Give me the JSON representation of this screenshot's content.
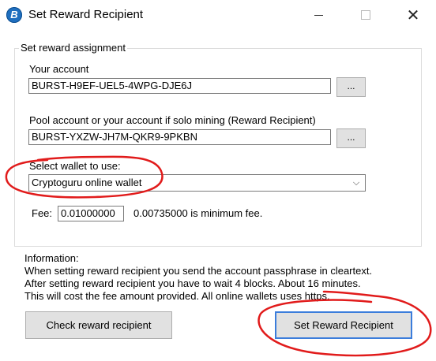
{
  "window": {
    "title": "Set Reward Recipient",
    "app_icon_glyph": "B",
    "controls": {
      "minimize_icon": "minimize-icon",
      "maximize_icon": "maximize-icon",
      "close_glyph": "✕"
    }
  },
  "group": {
    "label": "Set reward assignment",
    "your_account": {
      "label": "Your account",
      "value": "BURST-H9EF-UEL5-4WPG-DJE6J",
      "browse_label": "..."
    },
    "pool_account": {
      "label": "Pool account or your account if solo mining (Reward Recipient)",
      "value": "BURST-YXZW-JH7M-QKR9-9PKBN",
      "browse_label": "..."
    },
    "wallet": {
      "label": "Select wallet to use:",
      "selected": "Cryptoguru online wallet",
      "chevron_icon": "chevron-down-icon"
    },
    "fee": {
      "label": "Fee:",
      "value": "0.01000000",
      "note": "0.00735000 is minimum fee."
    }
  },
  "information": {
    "heading": "Information:",
    "lines": [
      "When setting reward recipient you send the account passphrase in cleartext.",
      "After setting reward recipient you have to wait 4 blocks. About 16 minutes.",
      "This will cost the fee amount provided. All online wallets uses https."
    ]
  },
  "buttons": {
    "check": "Check reward recipient",
    "set": "Set Reward Recipient"
  },
  "colors": {
    "annotation": "#e11b1b",
    "icon_blue": "#1f6fbf",
    "focus_border": "#3b7ddb"
  }
}
